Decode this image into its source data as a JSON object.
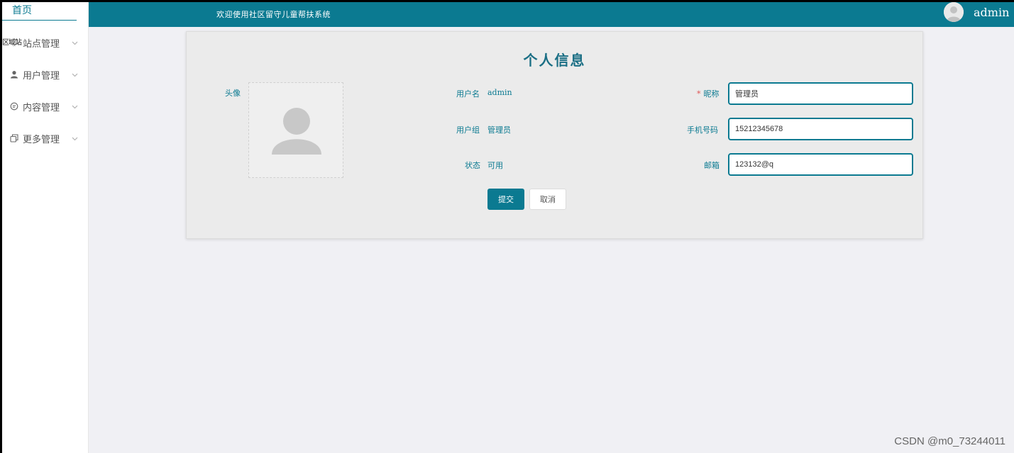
{
  "sidebar": {
    "home": "首页",
    "overlay": "区域站",
    "items": [
      {
        "label": "站点管理",
        "icon": "monitor-icon"
      },
      {
        "label": "用户管理",
        "icon": "user-icon"
      },
      {
        "label": "内容管理",
        "icon": "chat-icon"
      },
      {
        "label": "更多管理",
        "icon": "copy-icon"
      }
    ]
  },
  "header": {
    "title": "欢迎使用社区留守儿童帮扶系统",
    "user": "admin"
  },
  "profile": {
    "title": "个人信息",
    "avatar_label": "头像",
    "username_label": "用户名",
    "username_value": "admin",
    "group_label": "用户组",
    "group_value": "管理员",
    "status_label": "状态",
    "status_value": "可用",
    "nickname_label": "昵称",
    "nickname_required": "*",
    "nickname_value": "管理员",
    "phone_label": "手机号码",
    "phone_value": "15212345678",
    "email_label": "邮箱",
    "email_value": "123132@q",
    "submit_label": "提交",
    "cancel_label": "取消"
  },
  "watermark": "CSDN @m0_73244011",
  "colors": {
    "primary": "#0b7a91",
    "background": "#f0f0f4",
    "card": "#ebebeb",
    "required": "#e05656"
  }
}
